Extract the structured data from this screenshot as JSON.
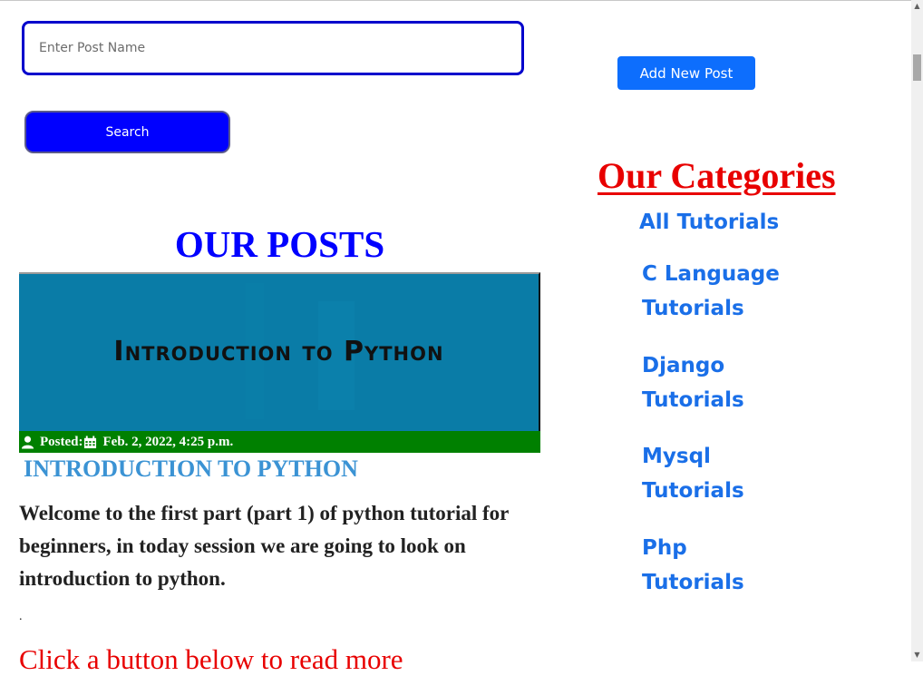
{
  "search": {
    "placeholder": "Enter Post Name",
    "button_label": "Search"
  },
  "add_post": {
    "label": "Add New Post"
  },
  "posts": {
    "heading": "OUR POSTS",
    "items": [
      {
        "image_text": "Introduction to Python",
        "posted_label": "Posted:",
        "date": "Feb. 2, 2022, 4:25 p.m.",
        "title": "INTRODUCTION TO PYTHON",
        "excerpt": "Welcome to the first part (part 1) of python tutorial for beginners, in today session we are going to look on introduction to python.",
        "separator": ".",
        "read_more": "Click a button below to read more"
      }
    ]
  },
  "categories": {
    "heading": "Our Categories",
    "items": [
      {
        "label": "All Tutorials"
      },
      {
        "label": "C Language Tutorials"
      },
      {
        "label": "Django Tutorials"
      },
      {
        "label": "Mysql Tutorials"
      },
      {
        "label": "Php Tutorials"
      }
    ]
  },
  "icons": {
    "author": "user-icon",
    "date": "calendar-icon"
  },
  "colors": {
    "search_border": "#0000cc",
    "search_button": "#0000ff",
    "add_button": "#0d6efd",
    "posts_heading": "#0000ff",
    "post_image_bg": "#0a7ca7",
    "meta_bar": "#008000",
    "post_title": "#3b93d4",
    "categories_heading": "#e80000",
    "category_link": "#1a6fe8",
    "read_more": "#e80000"
  }
}
